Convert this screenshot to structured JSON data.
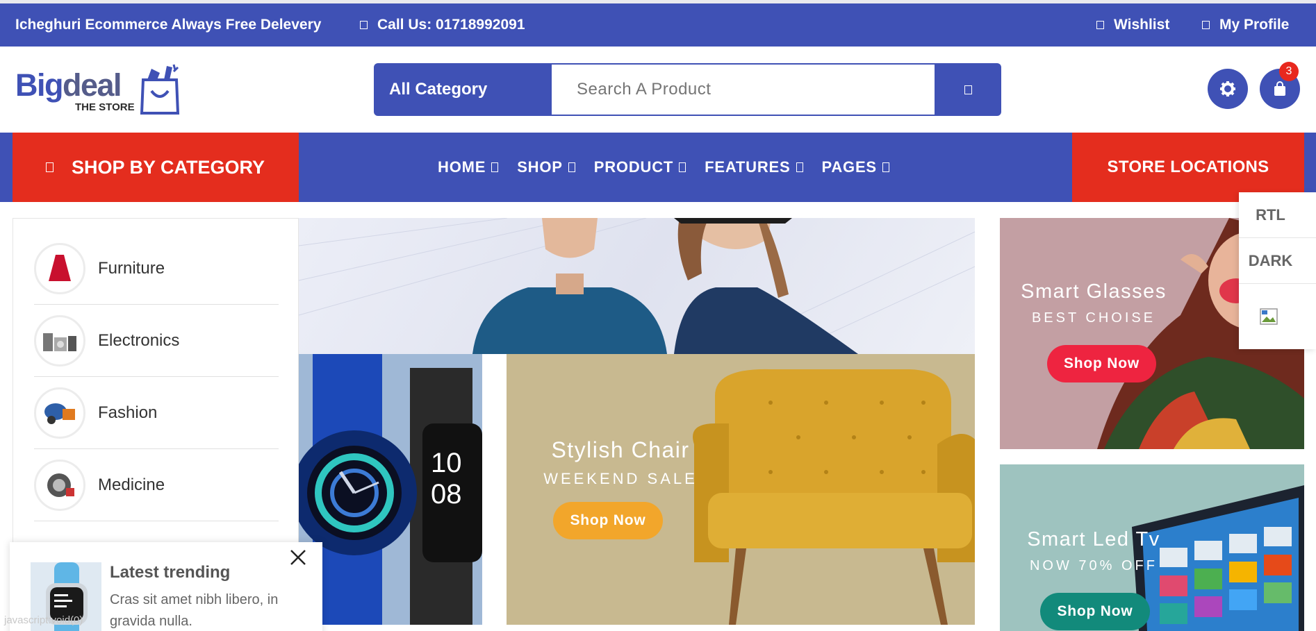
{
  "topbar": {
    "announcement": "Icheghuri Ecommerce Always Free Delevery",
    "phone": "Call Us: 01718992091",
    "wishlist": "Wishlist",
    "profile": "My Profile"
  },
  "brand": {
    "name_a": "Big",
    "name_b": "deal",
    "tagline": "THE STORE"
  },
  "search": {
    "category": "All Category",
    "placeholder": "Search A Product"
  },
  "cart": {
    "count": "3"
  },
  "nav": {
    "shop_by_category": "SHOP BY CATEGORY",
    "items": [
      "HOME",
      "SHOP",
      "PRODUCT",
      "FEATURES",
      "PAGES"
    ],
    "store_locations": "STORE LOCATIONS"
  },
  "categories": [
    "Furniture",
    "Electronics",
    "Fashion",
    "Medicine"
  ],
  "banners": {
    "chair": {
      "title": "Stylish Chair",
      "subtitle": "WEEKEND SALE",
      "button": "Shop Now"
    },
    "glasses": {
      "title": "Smart Glasses",
      "subtitle": "BEST CHOISE",
      "button": "Shop Now"
    },
    "tv": {
      "title": "Smart Led Tv",
      "subtitle": "NOW 70% OFF",
      "button": "Shop Now"
    }
  },
  "side_panel": {
    "rtl": "RTL",
    "dark": "DARK"
  },
  "toast": {
    "title": "Latest trending",
    "body": "Cras sit amet nibh libero, in gravida nulla."
  },
  "status_bar": "javascript:void(0)",
  "colors": {
    "primary": "#3f51b5",
    "accent_red": "#e42d1e",
    "chair_button": "#f2a62b",
    "glass_button": "#ee2440",
    "tv_button": "#128a7b"
  }
}
